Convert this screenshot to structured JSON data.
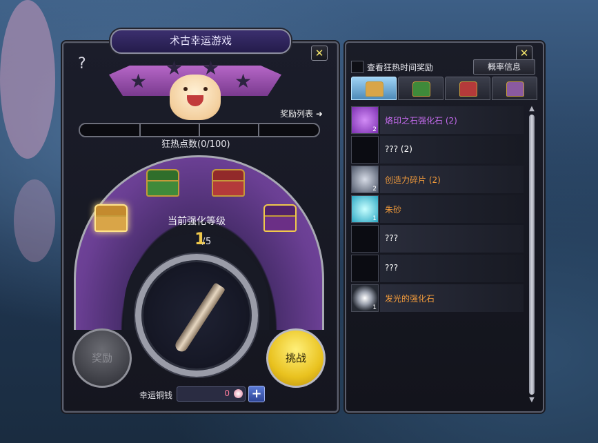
{
  "window": {
    "title": "术古幸运游戏"
  },
  "help": {
    "label": "?"
  },
  "close": {
    "label": "✕"
  },
  "rewards_link": {
    "label": "奖励列表",
    "arrow": "➜"
  },
  "fever": {
    "label": "狂热点数(0/100)",
    "current": 0,
    "max": 100
  },
  "stars": [
    "★",
    "★",
    "★",
    "★"
  ],
  "chests": [
    {
      "icon": "gold-chest-icon",
      "color": "#d9a548"
    },
    {
      "icon": "green-chest-icon",
      "color": "#3f8a3a"
    },
    {
      "icon": "red-chest-icon",
      "color": "#b43a3a"
    },
    {
      "icon": "ornate-purple-chest-icon",
      "color": "#6b2f86"
    }
  ],
  "enhance": {
    "label": "当前强化等级",
    "current": "1",
    "separator": "/",
    "max": "5"
  },
  "buttons": {
    "reward": "奖励",
    "challenge": "挑战"
  },
  "coins": {
    "label": "幸运铜钱",
    "value": "0",
    "add": "+"
  },
  "right_panel": {
    "fever_checkbox_label": "查看狂热时间奖励",
    "probability_button": "概率信息",
    "tabs": [
      {
        "icon": "gold-chest-icon"
      },
      {
        "icon": "green-chest-icon"
      },
      {
        "icon": "red-chest-icon"
      },
      {
        "icon": "ornate-chest-icon"
      }
    ],
    "scroll_up": "▲",
    "scroll_down": "▼"
  },
  "rewards": [
    {
      "name": "烙印之石强化石 (2)",
      "count": "2",
      "color": "#c76cf0",
      "icon": "purple-seal-stone-icon"
    },
    {
      "name": "??? (2)",
      "count": "",
      "color": "#ffffff",
      "icon": "unknown-icon"
    },
    {
      "name": "创造力碎片 (2)",
      "count": "2",
      "color": "#f09a3c",
      "icon": "crystal-fragment-icon"
    },
    {
      "name": "朱砂",
      "count": "1",
      "color": "#f09a3c",
      "icon": "cyan-gem-icon"
    },
    {
      "name": "???",
      "count": "",
      "color": "#ffffff",
      "icon": "unknown-icon"
    },
    {
      "name": "???",
      "count": "",
      "color": "#ffffff",
      "icon": "unknown-icon"
    },
    {
      "name": "发光的强化石",
      "count": "1",
      "color": "#f09a3c",
      "icon": "glowing-stone-icon"
    }
  ]
}
